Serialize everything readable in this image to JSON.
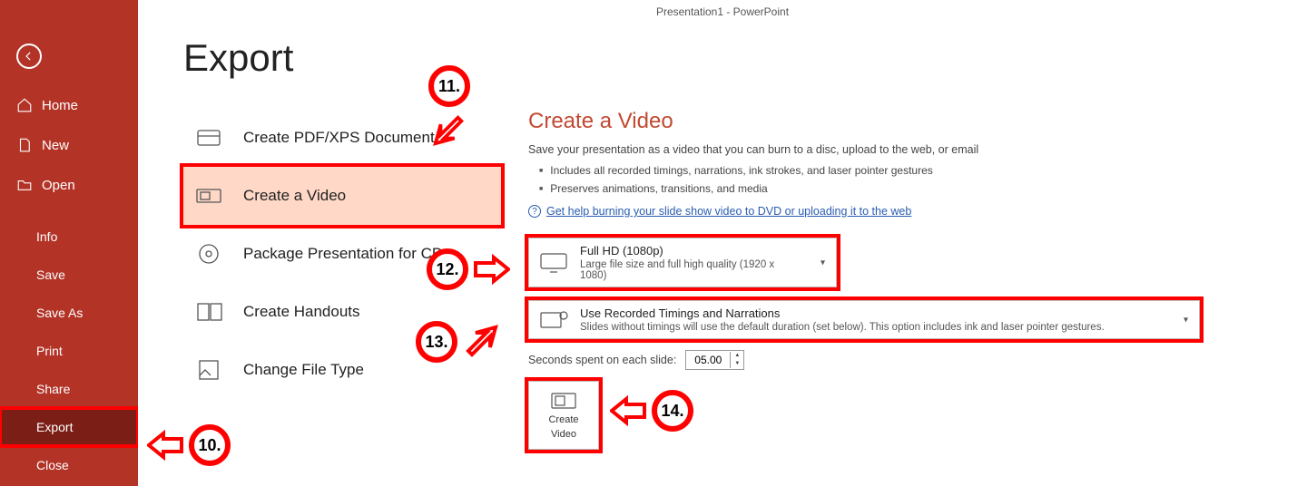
{
  "window_title": "Presentation1 - PowerPoint",
  "page_title": "Export",
  "sidebar": {
    "top": [
      {
        "label": "Home",
        "icon": "home-icon"
      },
      {
        "label": "New",
        "icon": "new-icon"
      },
      {
        "label": "Open",
        "icon": "open-icon"
      }
    ],
    "bottom": [
      {
        "label": "Info"
      },
      {
        "label": "Save"
      },
      {
        "label": "Save As"
      },
      {
        "label": "Print"
      },
      {
        "label": "Share"
      },
      {
        "label": "Export"
      },
      {
        "label": "Close"
      }
    ]
  },
  "options": [
    {
      "label": "Create PDF/XPS Document",
      "icon": "pdf-icon"
    },
    {
      "label": "Create a Video",
      "icon": "video-icon"
    },
    {
      "label": "Package Presentation for CD",
      "icon": "cd-icon"
    },
    {
      "label": "Create Handouts",
      "icon": "handouts-icon"
    },
    {
      "label": "Change File Type",
      "icon": "filetype-icon"
    }
  ],
  "pane": {
    "title": "Create a Video",
    "desc": "Save your presentation as a video that you can burn to a disc, upload to the web, or email",
    "bullets": [
      "Includes all recorded timings, narrations, ink strokes, and laser pointer gestures",
      "Preserves animations, transitions, and media"
    ],
    "help_link": "Get help burning your slide show video to DVD or uploading it to the web",
    "quality": {
      "title": "Full HD (1080p)",
      "sub": "Large file size and full high quality (1920 x 1080)"
    },
    "timings": {
      "title": "Use Recorded Timings and Narrations",
      "sub": "Slides without timings will use the default duration (set below). This option includes ink and laser pointer gestures."
    },
    "seconds_label": "Seconds spent on each slide:",
    "seconds_value": "05.00",
    "create_button_l1": "Create",
    "create_button_l2": "Video"
  },
  "callouts": {
    "c10": "10.",
    "c11": "11.",
    "c12": "12.",
    "c13": "13.",
    "c14": "14."
  }
}
